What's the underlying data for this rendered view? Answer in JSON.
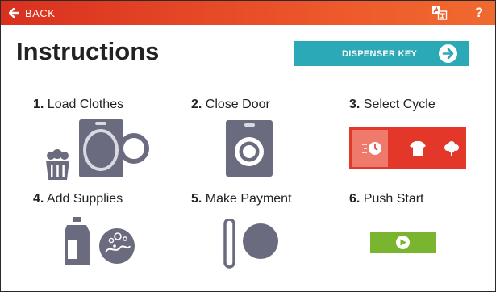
{
  "header": {
    "back_label": "BACK",
    "icons": [
      "back-arrow-icon",
      "translate-icon",
      "help-icon"
    ],
    "help_label": "?"
  },
  "page": {
    "title": "Instructions",
    "dispenser_button_label": "DISPENSER KEY"
  },
  "steps": [
    {
      "number": "1.",
      "label": "Load Clothes"
    },
    {
      "number": "2.",
      "label": "Close Door"
    },
    {
      "number": "3.",
      "label": "Select Cycle"
    },
    {
      "number": "4.",
      "label": "Add Supplies"
    },
    {
      "number": "5.",
      "label": "Make Payment"
    },
    {
      "number": "6.",
      "label": "Push Start"
    }
  ],
  "colors": {
    "header": "#e8462a",
    "accent": "#2ba9b6",
    "icon_gray": "#6b6b80",
    "cycle_red": "#e3372a",
    "start_green": "#7ab530"
  }
}
